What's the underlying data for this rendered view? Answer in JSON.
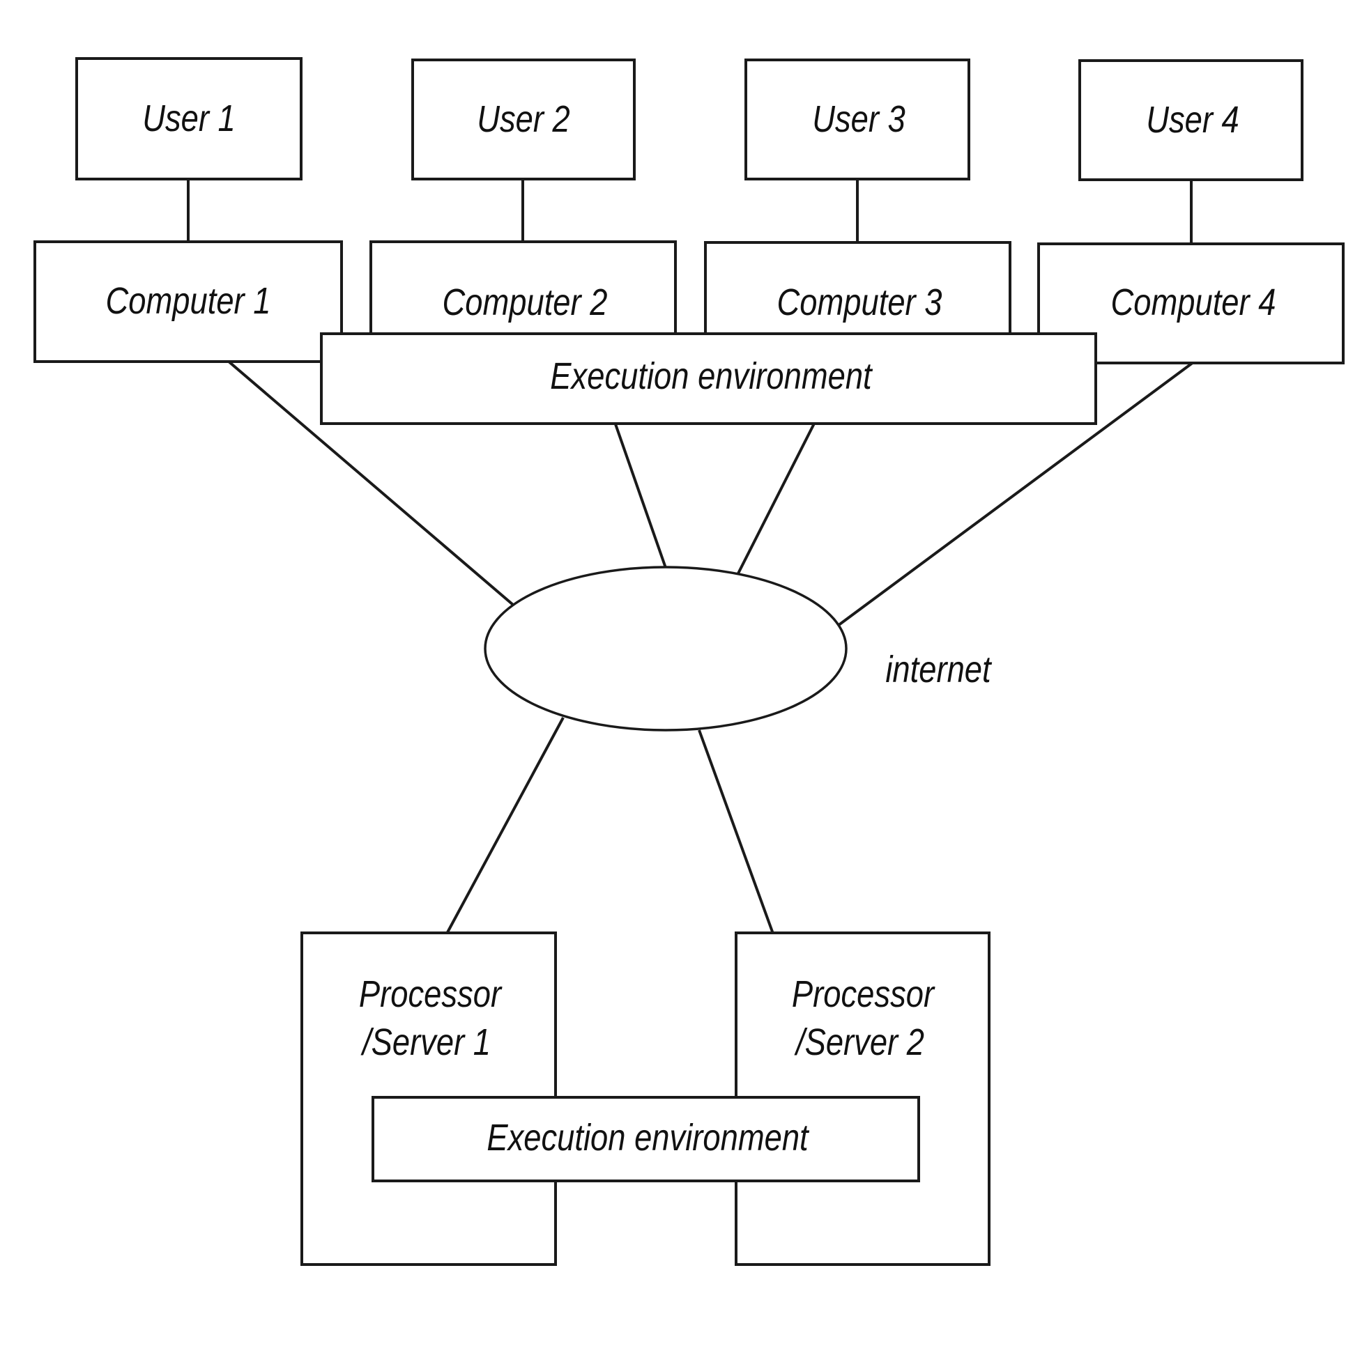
{
  "diagram": {
    "users": [
      {
        "label": "User 1"
      },
      {
        "label": "User 2"
      },
      {
        "label": "User 3"
      },
      {
        "label": "User 4"
      }
    ],
    "computers": [
      {
        "label": "Computer 1"
      },
      {
        "label": "Computer 2"
      },
      {
        "label": "Computer 3"
      },
      {
        "label": "Computer 4"
      }
    ],
    "client_execution_environment": {
      "label": "Execution environment"
    },
    "network": {
      "label": "internet"
    },
    "servers": [
      {
        "label_line1": "Processor",
        "label_line2": "/Server 1"
      },
      {
        "label_line1": "Processor",
        "label_line2": "/Server 2"
      }
    ],
    "server_execution_environment": {
      "label": "Execution environment"
    },
    "connections": [
      {
        "from": "User 1",
        "to": "Computer 1"
      },
      {
        "from": "User 2",
        "to": "Computer 2"
      },
      {
        "from": "User 3",
        "to": "Computer 3"
      },
      {
        "from": "User 4",
        "to": "Computer 4"
      },
      {
        "from": "Computer 1",
        "to": "internet"
      },
      {
        "from": "Execution environment",
        "to": "internet"
      },
      {
        "from": "Execution environment",
        "to": "internet"
      },
      {
        "from": "Computer 4",
        "to": "internet"
      },
      {
        "from": "internet",
        "to": "Processor/Server 1"
      },
      {
        "from": "internet",
        "to": "Processor/Server 2"
      }
    ]
  }
}
